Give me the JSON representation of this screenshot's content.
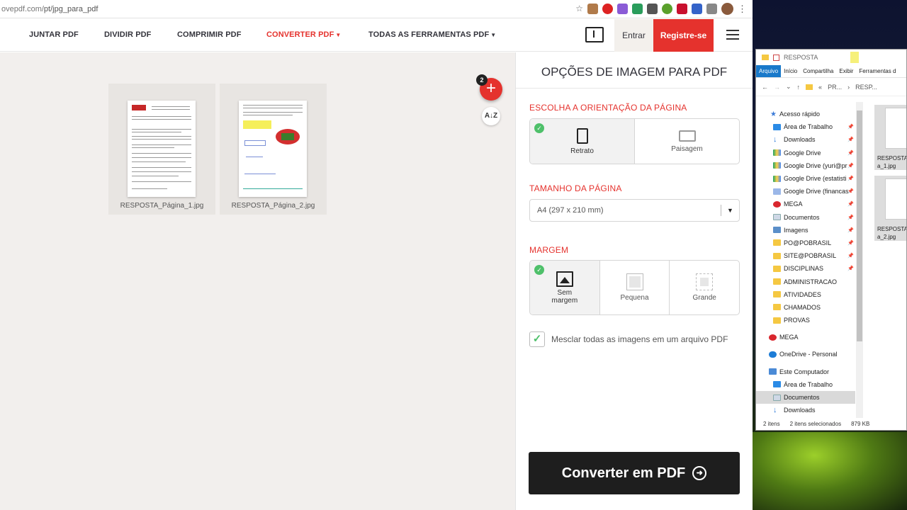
{
  "browser": {
    "url_prefix": "ovepdf.com/",
    "url_path": "pt/jpg_para_pdf"
  },
  "nav": {
    "items": [
      "JUNTAR PDF",
      "DIVIDIR PDF",
      "COMPRIMIR PDF",
      "CONVERTER PDF",
      "TODAS AS FERRAMENTAS PDF"
    ],
    "login": "Entrar",
    "signup": "Registre-se"
  },
  "workspace": {
    "badge_count": "2",
    "files": [
      {
        "name": "RESPOSTA_Página_1.jpg"
      },
      {
        "name": "RESPOSTA_Página_2.jpg"
      }
    ]
  },
  "panel": {
    "title": "OPÇÕES DE IMAGEM PARA PDF",
    "orientation_label": "ESCOLHA A ORIENTAÇÃO DA PÁGINA",
    "orientation_options": [
      "Retrato",
      "Paisagem"
    ],
    "page_size_label": "TAMANHO DA PÁGINA",
    "page_size_value": "A4 (297 x 210 mm)",
    "margin_label": "MARGEM",
    "margin_options": [
      "Sem margem",
      "Pequena",
      "Grande"
    ],
    "merge_label": "Mesclar todas as imagens em um arquivo PDF",
    "convert_button": "Converter em PDF"
  },
  "explorer": {
    "title": "RESPOSTA",
    "ribbon": [
      "Arquivo",
      "Início",
      "Compartilha",
      "Exibir",
      "Ferramentas d"
    ],
    "address": [
      "PR...",
      "RESP..."
    ],
    "tree": [
      "Acesso rápido",
      "Área de Trabalho",
      "Downloads",
      "Google Drive",
      "Google Drive (yuri@pr",
      "Google Drive (estatisti",
      "Google Drive (financas",
      "MEGA",
      "Documentos",
      "Imagens",
      "PO@POBRASIL",
      "SITE@POBRASIL",
      "DISCIPLINAS",
      "ADMINISTRACAO",
      "ATIVIDADES",
      "CHAMADOS",
      "PROVAS",
      "MEGA",
      "OneDrive - Personal",
      "Este Computador",
      "Área de Trabalho",
      "Documentos",
      "Downloads"
    ],
    "file_names": [
      "RESPOSTA a_1.jpg",
      "RESPOSTA a_2.jpg"
    ],
    "status_items": "2 itens",
    "status_selected": "2 itens selecionados",
    "status_size": "879 KB"
  },
  "colors": {
    "accent": "#e5322d",
    "dark": "#1e1e1e",
    "success": "#4ec06a"
  }
}
